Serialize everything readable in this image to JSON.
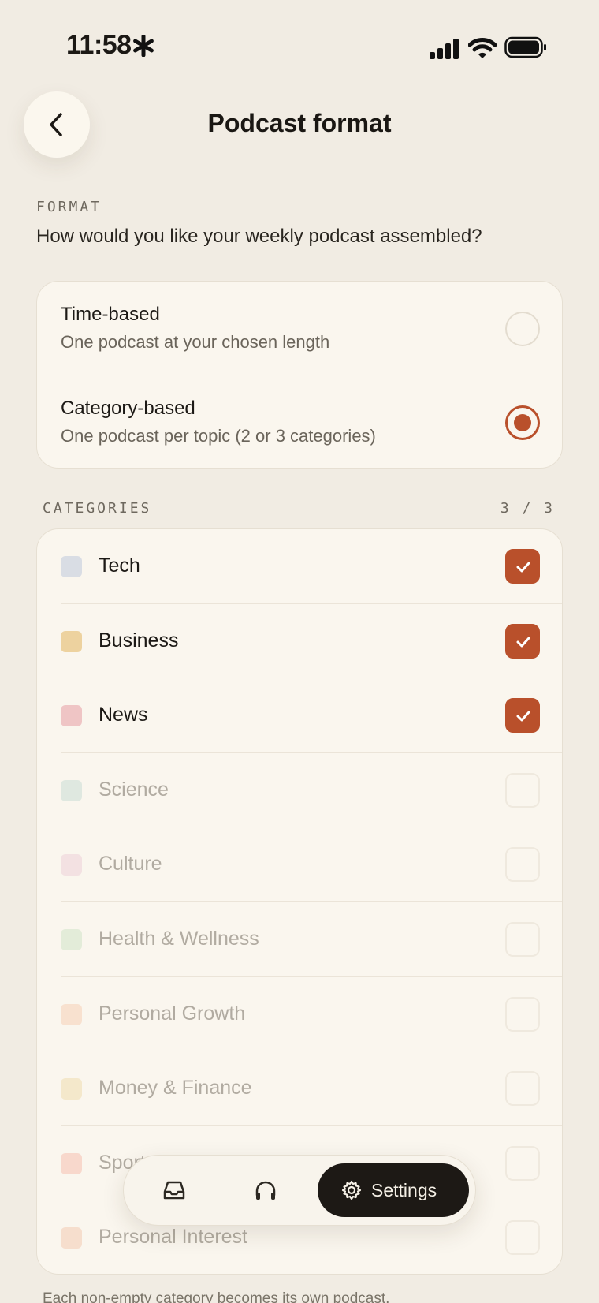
{
  "status_bar": {
    "time": "11:58"
  },
  "header": {
    "title": "Podcast format"
  },
  "format": {
    "section_label": "FORMAT",
    "question": "How would you like your weekly podcast assembled?",
    "options": [
      {
        "title": "Time-based",
        "subtitle": "One podcast at your chosen length",
        "selected": false
      },
      {
        "title": "Category-based",
        "subtitle": "One podcast per topic (2 or 3 categories)",
        "selected": true
      }
    ]
  },
  "categories": {
    "section_label": "CATEGORIES",
    "count": "3 / 3",
    "items": [
      {
        "label": "Tech",
        "color": "#d9dde4",
        "checked": true,
        "enabled": true
      },
      {
        "label": "Business",
        "color": "#edd29f",
        "checked": true,
        "enabled": true
      },
      {
        "label": "News",
        "color": "#efc5c5",
        "checked": true,
        "enabled": true
      },
      {
        "label": "Science",
        "color": "#c9ddd5",
        "checked": false,
        "enabled": false
      },
      {
        "label": "Culture",
        "color": "#edcfd9",
        "checked": false,
        "enabled": false
      },
      {
        "label": "Health & Wellness",
        "color": "#cfe3c8",
        "checked": false,
        "enabled": false
      },
      {
        "label": "Personal Growth",
        "color": "#f5cfb6",
        "checked": false,
        "enabled": false
      },
      {
        "label": "Money & Finance",
        "color": "#eedcae",
        "checked": false,
        "enabled": false
      },
      {
        "label": "Sports",
        "color": "#f6bfb0",
        "checked": false,
        "enabled": false
      },
      {
        "label": "Personal Interest",
        "color": "#f3cbb3",
        "checked": false,
        "enabled": false
      }
    ]
  },
  "footer_note": "Each non-empty category becomes its own podcast.",
  "tab_bar": {
    "inbox_icon": "inbox-icon",
    "listen_icon": "headphones-icon",
    "settings_label": "Settings"
  },
  "colors": {
    "accent": "#b9502b",
    "background": "#f1ece3",
    "card": "#faf6ee"
  }
}
